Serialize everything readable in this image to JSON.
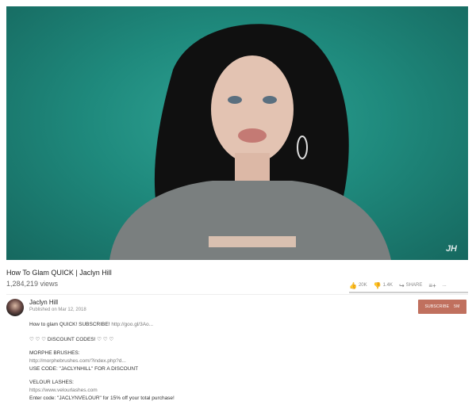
{
  "player": {
    "watermark": "JH"
  },
  "video": {
    "title": "How To Glam QUICK | Jaclyn Hill",
    "views": "1,284,219 views"
  },
  "actions": {
    "likes": "20K",
    "dislikes": "1.4K",
    "share_label": "SHARE",
    "more_label": "..."
  },
  "channel": {
    "name": "Jaclyn Hill",
    "published": "Published on Mar 12, 2018",
    "subscribe_label": "SUBSCRIBE",
    "subscriber_count": "5M"
  },
  "description": {
    "line1_text": "How to glam QUICK! SUBSCRIBE!",
    "line1_link": "http://goo.gl/3Ao...",
    "discount_header": "♡ ♡ ♡ DISCOUNT CODES! ♡ ♡ ♡",
    "morphe_title": "MORPHE BRUSHES:",
    "morphe_link": "http://morphebrushes.com/?index.php?d...",
    "morphe_code": "USE CODE: \"JACLYNHILL\" FOR A DISCOUNT",
    "veldour_title": "VELOUR LASHES:",
    "veldour_link": "https://www.velourlashes.com",
    "veldour_code": "Enter code: \"JACLYNVELOUR\" for 15% off your total purchase!"
  },
  "colors": {
    "video_bg": "#1f8a7d",
    "subscribe_bg": "#c0705e"
  }
}
